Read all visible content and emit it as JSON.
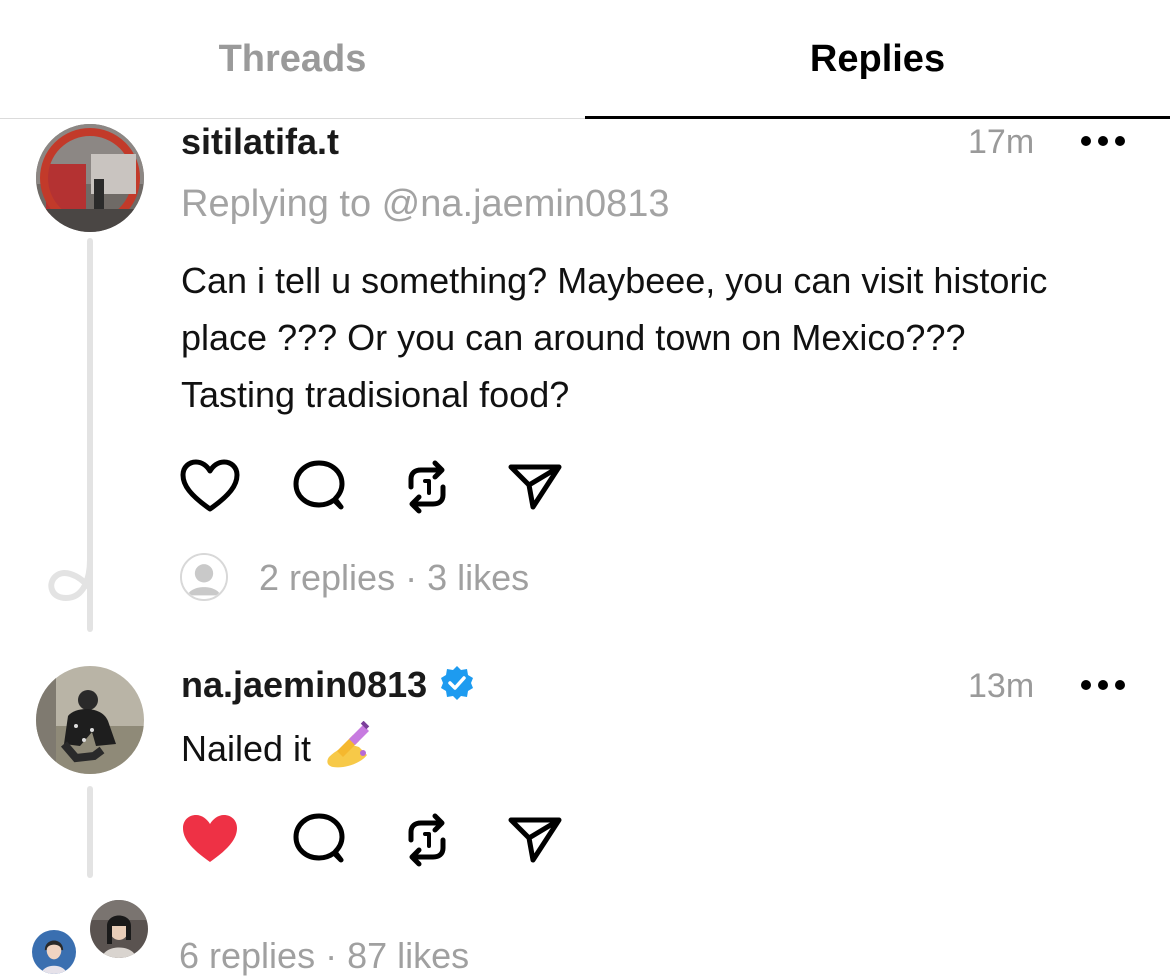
{
  "tabs": {
    "threads_label": "Threads",
    "replies_label": "Replies",
    "active": "Replies"
  },
  "posts": [
    {
      "username": "sitilatifa.t",
      "time": "17m",
      "replying_to": "Replying to @na.jaemin0813",
      "text": "Can i tell u something? Maybeee, you can visit historic place ??? Or you can around town on Mexico??? Tasting tradisional food?",
      "liked": false,
      "replies_summary": "2 replies · 3 likes"
    },
    {
      "username": "na.jaemin0813",
      "verified": true,
      "time": "13m",
      "text": "Nailed it",
      "emoji": "nail-polish",
      "liked": true,
      "like_color": "#ee3145",
      "replies_summary": "6 replies · 87 likes"
    }
  ],
  "colors": {
    "verified_badge": "#1d9bf0",
    "muted_text": "#9a9a9a"
  }
}
